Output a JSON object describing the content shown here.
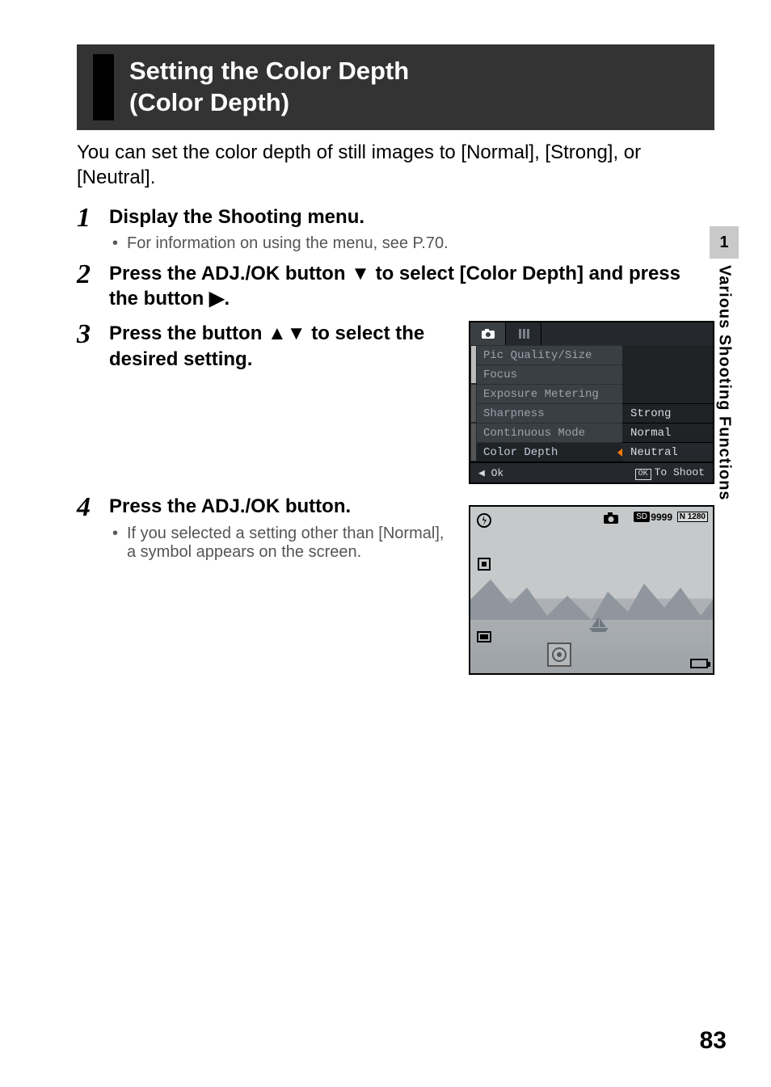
{
  "section": {
    "title_line1": "Setting the Color Depth",
    "title_line2": "(Color Depth)"
  },
  "intro": "You can set the color depth of still images to [Normal], [Strong], or [Neutral].",
  "steps": {
    "s1": {
      "num": "1",
      "title": "Display the Shooting menu.",
      "bullet": "For information on using the menu, see P.70."
    },
    "s2": {
      "num": "2",
      "title_a": "Press the ADJ./OK button ",
      "title_b": " to select [Color Depth] and press the button ",
      "title_c": ".",
      "glyph_down": "▼",
      "glyph_right": "▶"
    },
    "s3": {
      "num": "3",
      "title_a": "Press the button ",
      "title_b": " to select the desired setting.",
      "glyph_updown": "▲▼"
    },
    "s4": {
      "num": "4",
      "title": "Press the ADJ./OK button.",
      "bullet": "If you selected a setting other than [Normal], a symbol appears on the screen."
    }
  },
  "menu": {
    "items": [
      "Pic Quality/Size",
      "Focus",
      "Exposure Metering",
      "Sharpness",
      "Continuous Mode",
      "Color Depth"
    ],
    "options": [
      "Strong",
      "Normal",
      "Neutral"
    ],
    "footer_left": "◀ Ok",
    "footer_ok": "OK",
    "footer_right": "To Shoot"
  },
  "live": {
    "sd": "SD",
    "count": "9999",
    "nchip": "N 1280"
  },
  "sidebar": {
    "num": "1",
    "label": "Various Shooting Functions"
  },
  "page_number": "83"
}
